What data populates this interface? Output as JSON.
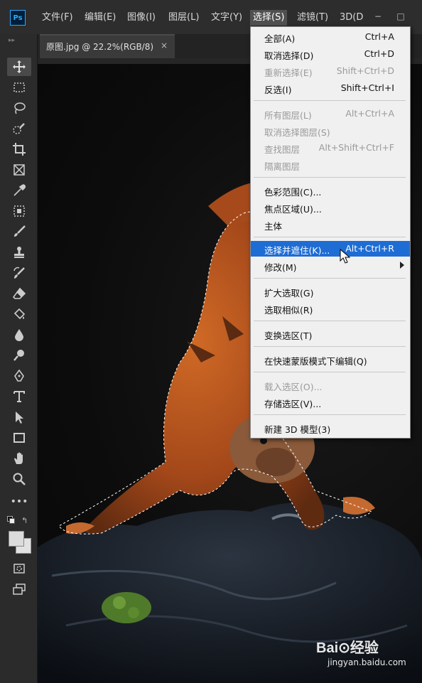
{
  "app": {
    "logo": "Ps"
  },
  "menubar": {
    "items": [
      "文件(F)",
      "编辑(E)",
      "图像(I)",
      "图层(L)",
      "文字(Y)",
      "选择(S)",
      "滤镜(T)",
      "3D(D"
    ],
    "active": "选择(S)",
    "window_controls": [
      "−",
      "□"
    ]
  },
  "document_tab": {
    "title": "原图.jpg @ 22.2%(RGB/8)",
    "close": "×"
  },
  "toolbar": {
    "tools": [
      "move-tool",
      "marquee-tool",
      "lasso-tool",
      "quick-selection-tool",
      "crop-tool",
      "frame-tool",
      "eyedropper-tool",
      "healing-brush-tool",
      "brush-tool",
      "clone-stamp-tool",
      "history-brush-tool",
      "eraser-tool",
      "paint-bucket-tool",
      "blur-tool",
      "dodge-tool",
      "pen-tool",
      "type-tool",
      "path-selection-tool",
      "rectangle-tool",
      "hand-tool",
      "zoom-tool",
      "more-tools"
    ],
    "more_label": "•••"
  },
  "select_menu": {
    "items": [
      {
        "label": "全部(A)",
        "shortcut": "Ctrl+A",
        "enabled": true
      },
      {
        "label": "取消选择(D)",
        "shortcut": "Ctrl+D",
        "enabled": true
      },
      {
        "label": "重新选择(E)",
        "shortcut": "Shift+Ctrl+D",
        "enabled": false
      },
      {
        "label": "反选(I)",
        "shortcut": "Shift+Ctrl+I",
        "enabled": true
      },
      {
        "label": "所有图层(L)",
        "shortcut": "Alt+Ctrl+A",
        "enabled": false
      },
      {
        "label": "取消选择图层(S)",
        "shortcut": "",
        "enabled": false
      },
      {
        "label": "查找图层",
        "shortcut": "Alt+Shift+Ctrl+F",
        "enabled": false
      },
      {
        "label": "隔离图层",
        "shortcut": "",
        "enabled": false
      },
      {
        "label": "色彩范围(C)...",
        "shortcut": "",
        "enabled": true
      },
      {
        "label": "焦点区域(U)...",
        "shortcut": "",
        "enabled": true
      },
      {
        "label": "主体",
        "shortcut": "",
        "enabled": true
      },
      {
        "label": "选择并遮住(K)...",
        "shortcut": "Alt+Ctrl+R",
        "enabled": true,
        "highlighted": true
      },
      {
        "label": "修改(M)",
        "shortcut": "",
        "enabled": true,
        "submenu": true
      },
      {
        "label": "扩大选取(G)",
        "shortcut": "",
        "enabled": true
      },
      {
        "label": "选取相似(R)",
        "shortcut": "",
        "enabled": true
      },
      {
        "label": "变换选区(T)",
        "shortcut": "",
        "enabled": true
      },
      {
        "label": "在快速蒙版模式下编辑(Q)",
        "shortcut": "",
        "enabled": true
      },
      {
        "label": "载入选区(O)...",
        "shortcut": "",
        "enabled": false
      },
      {
        "label": "存储选区(V)...",
        "shortcut": "",
        "enabled": true
      },
      {
        "label": "新建 3D 模型(3)",
        "shortcut": "",
        "enabled": true
      }
    ]
  },
  "watermark": {
    "logo": "Bai⊙经验",
    "url": "jingyan.baidu.com"
  },
  "colors": {
    "menu_highlight": "#1e6dd4",
    "fur": "#b8561c",
    "selection_ants": "#ffffff"
  }
}
